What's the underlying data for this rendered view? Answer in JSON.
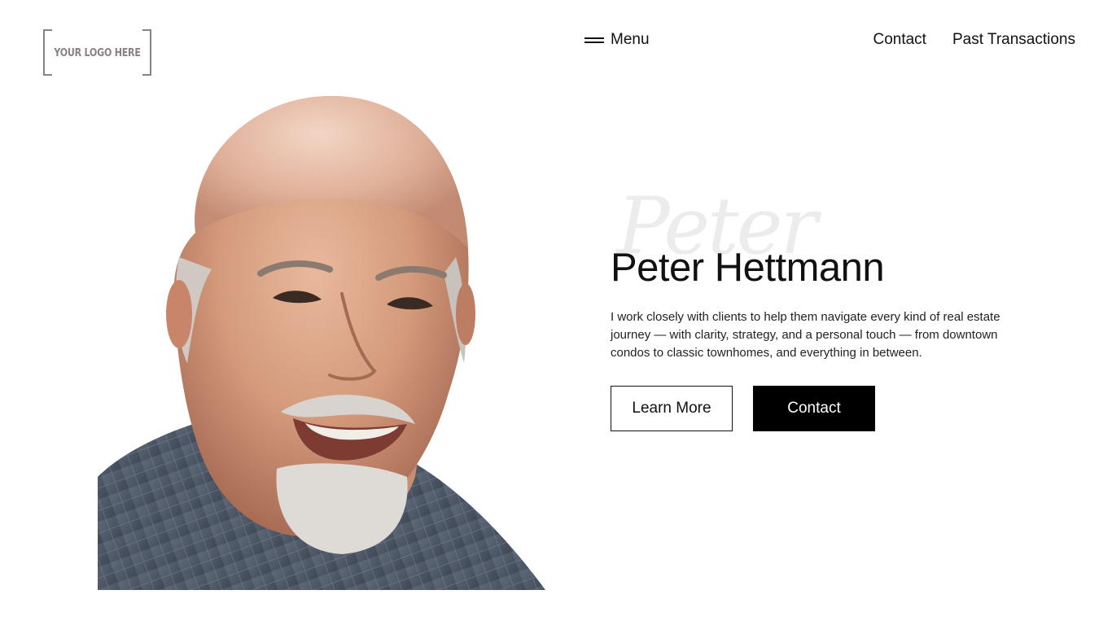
{
  "logo": {
    "text": "YOUR LOGO HERE"
  },
  "menu": {
    "label": "Menu",
    "icon": "hamburger-icon"
  },
  "nav": {
    "items": [
      "Contact",
      "Past Transactions"
    ]
  },
  "hero": {
    "script_name": "Peter",
    "title": "Peter Hettmann",
    "description": "I work closely with clients to help them navigate every kind of real estate journey — with clarity, strategy, and a personal touch — from downtown condos to classic townhomes, and everything in between.",
    "buttons": {
      "primary_outline": "Learn More",
      "solid": "Contact"
    }
  },
  "colors": {
    "text": "#111111",
    "logo": "#8a8087",
    "button_solid": "#000000",
    "watermark": "#ececec"
  }
}
